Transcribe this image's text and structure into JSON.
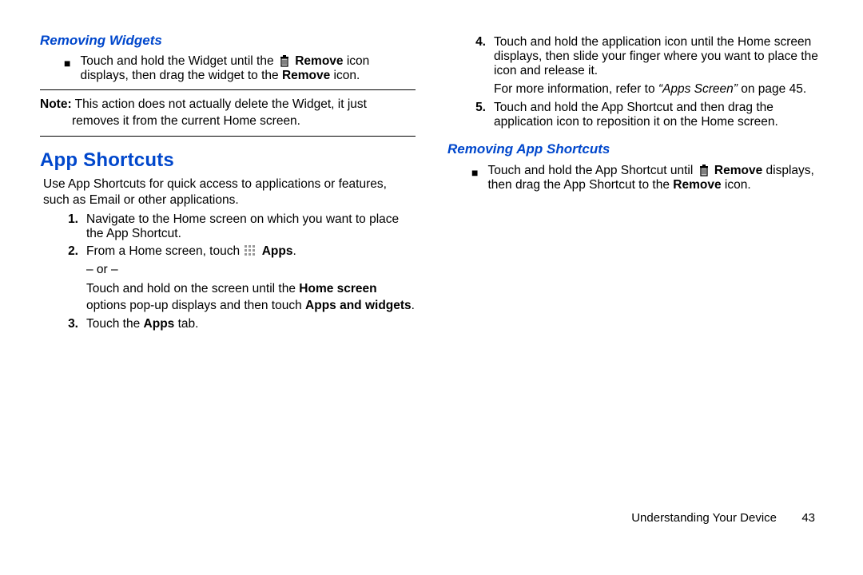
{
  "left": {
    "removing_widgets_head": "Removing Widgets",
    "rw_bullet_pre": "Touch and hold the Widget until the ",
    "rw_bullet_icon_label": "Remove",
    "rw_bullet_mid": " icon displays, then drag the widget to the ",
    "rw_bullet_bold2": "Remove",
    "rw_bullet_end": " icon.",
    "note_label": "Note:",
    "note_text_line1": " This action does not actually delete the Widget, it just",
    "note_text_line2": "removes it from the current Home screen.",
    "app_shortcuts_head": "App Shortcuts",
    "as_intro": "Use App Shortcuts for quick access to applications or features, such as Email or other applications.",
    "step1_num": "1.",
    "step1": "Navigate to the Home screen on which you want to place the App Shortcut.",
    "step2_num": "2.",
    "step2_pre": "From a Home screen, touch ",
    "step2_apps": "Apps",
    "step2_end": ".",
    "or": "– or –",
    "step2_alt_pre": "Touch and hold on the screen until the ",
    "step2_alt_bold1": "Home screen",
    "step2_alt_mid": " options pop-up displays and then touch ",
    "step2_alt_bold2": "Apps and widgets",
    "step2_alt_end": ".",
    "step3_num": "3.",
    "step3_pre": "Touch the ",
    "step3_bold": "Apps",
    "step3_end": " tab."
  },
  "right": {
    "step4_num": "4.",
    "step4": "Touch and hold the application icon until the Home screen displays, then slide your finger where you want to place the icon and release it.",
    "step4_more_pre": "For more information, refer to ",
    "step4_more_ital": "“Apps Screen”",
    "step4_more_end": " on page 45.",
    "step5_num": "5.",
    "step5": "Touch and hold the App Shortcut and then drag the application icon to reposition it on the Home screen.",
    "removing_as_head": "Removing App Shortcuts",
    "ras_pre": "Touch and hold the App Shortcut until ",
    "ras_icon_label": "Remove",
    "ras_mid": " displays, then drag the App Shortcut to the ",
    "ras_bold2": "Remove",
    "ras_end": " icon."
  },
  "footer": {
    "section": "Understanding Your Device",
    "page": "43"
  }
}
